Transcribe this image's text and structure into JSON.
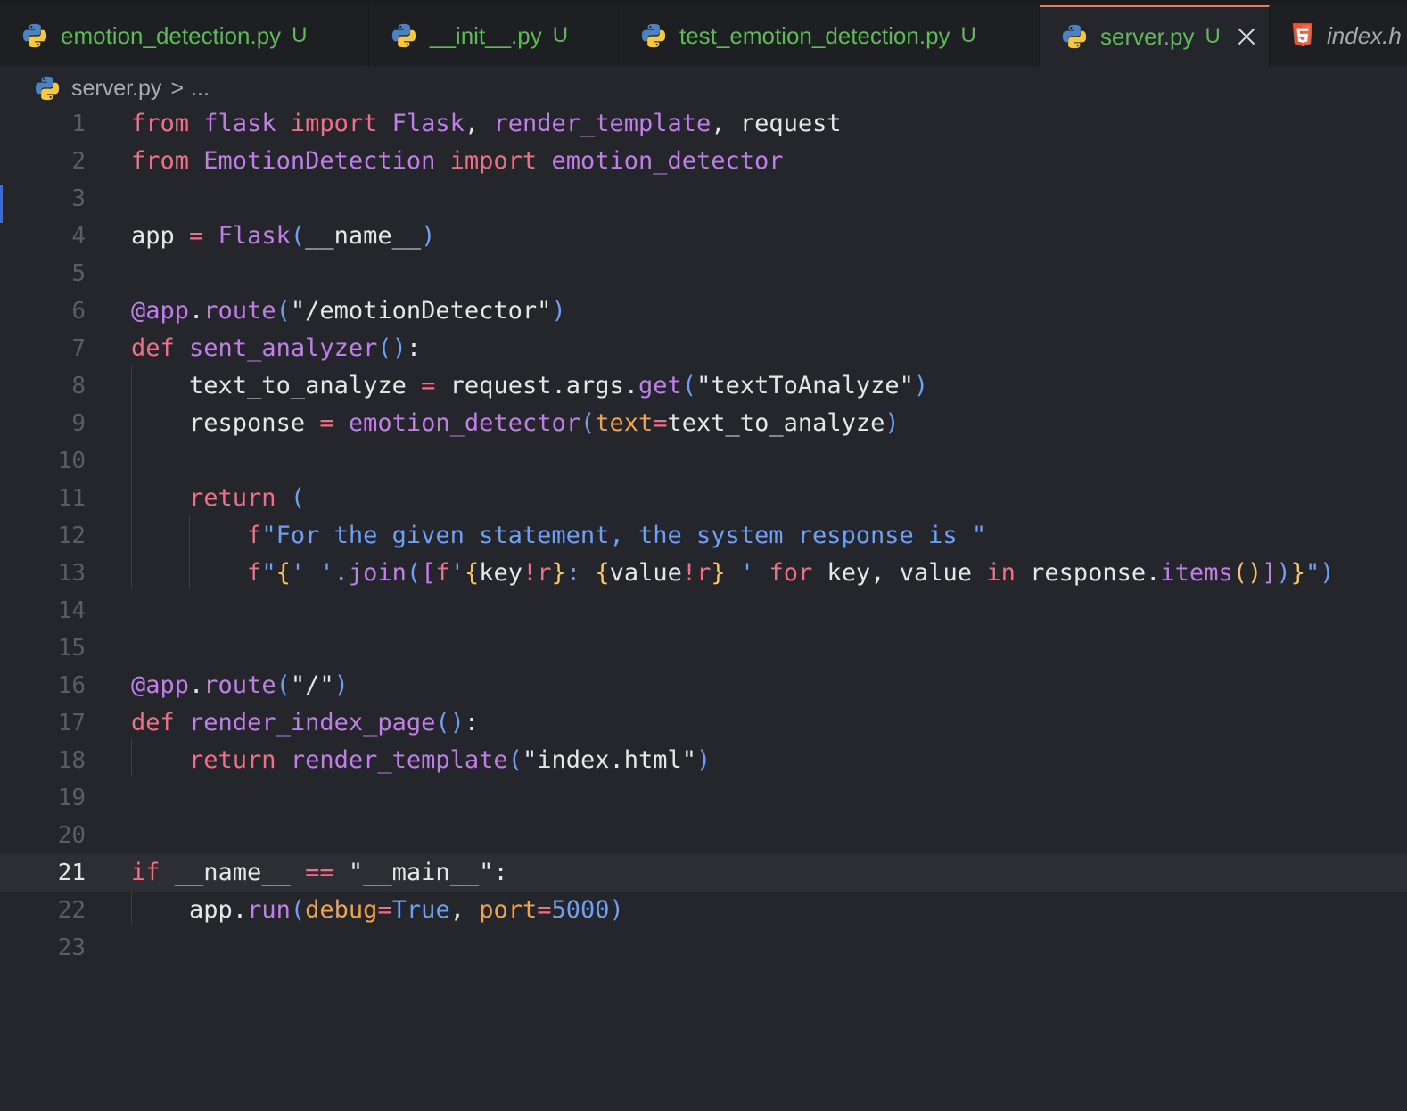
{
  "tabs": [
    {
      "label": "emotion_detection.py",
      "status": "U",
      "icon": "python-icon"
    },
    {
      "label": "__init__.py",
      "status": "U",
      "icon": "python-icon"
    },
    {
      "label": "test_emotion_detection.py",
      "status": "U",
      "icon": "python-icon"
    },
    {
      "label": "server.py",
      "status": "U",
      "icon": "python-icon",
      "active": true
    },
    {
      "label": "index.h",
      "status": "",
      "icon": "html5-icon"
    }
  ],
  "breadcrumb": {
    "file": "server.py",
    "separator": ">",
    "more": "..."
  },
  "editor": {
    "current_line": 21,
    "line_numbers": [
      "1",
      "2",
      "3",
      "4",
      "5",
      "6",
      "7",
      "8",
      "9",
      "10",
      "11",
      "12",
      "13",
      "14",
      "15",
      "16",
      "17",
      "18",
      "19",
      "20",
      "21",
      "22",
      "23"
    ],
    "code": {
      "l1": [
        "from",
        " ",
        "flask",
        " ",
        "import",
        " ",
        "Flask",
        ", ",
        "render_template",
        ", ",
        "request"
      ],
      "l2": [
        "from",
        " ",
        "EmotionDetection",
        " ",
        "import",
        " ",
        "emotion_detector"
      ],
      "l4": [
        "app",
        " ",
        "=",
        " ",
        "Flask",
        "(",
        "__name__",
        ")"
      ],
      "l6": [
        "@app",
        ".",
        "route",
        "(",
        "\"/emotionDetector\"",
        ")"
      ],
      "l7": [
        "def",
        " ",
        "sent_analyzer",
        "()",
        ":"
      ],
      "l8": [
        "    ",
        "text_to_analyze",
        " ",
        "=",
        " ",
        "request",
        ".",
        "args",
        ".",
        "get",
        "(",
        "\"textToAnalyze\"",
        ")"
      ],
      "l9": [
        "    ",
        "response",
        " ",
        "=",
        " ",
        "emotion_detector",
        "(",
        "text",
        "=",
        "text_to_analyze",
        ")"
      ],
      "l11": [
        "    ",
        "return",
        " ",
        "("
      ],
      "l12": [
        "        ",
        "f",
        "\"For the given statement, the system response is \""
      ],
      "l13": [
        "        ",
        "f",
        "\"",
        "{",
        "' '",
        ".",
        "join",
        "(",
        "[",
        "f",
        "'",
        "{",
        "key",
        "!r",
        "}",
        ": ",
        "{",
        "value",
        "!r",
        "}",
        " '",
        " ",
        "for",
        " ",
        "key",
        ", ",
        "value",
        " ",
        "in",
        " ",
        "response",
        ".",
        "items",
        "()",
        "]",
        ")",
        "}",
        "\"",
        ")"
      ],
      "l16": [
        "@app",
        ".",
        "route",
        "(",
        "\"/\"",
        ")"
      ],
      "l17": [
        "def",
        " ",
        "render_index_page",
        "()",
        ":"
      ],
      "l18": [
        "    ",
        "return",
        " ",
        "render_template",
        "(",
        "\"index.html\"",
        ")"
      ],
      "l21": [
        "if",
        " ",
        "__name__",
        " ",
        "==",
        " ",
        "\"__main__\"",
        ":"
      ],
      "l22": [
        "    ",
        "app",
        ".",
        "run",
        "(",
        "debug",
        "=",
        "True",
        ", ",
        "port",
        "=",
        "5000",
        ")"
      ]
    }
  },
  "colors": {
    "keyword": "#ee6f86",
    "function": "#c07ee8",
    "bracket": "#6e9ef5",
    "param": "#f1a24a",
    "modified": "#5fb958",
    "background": "#24262b"
  }
}
